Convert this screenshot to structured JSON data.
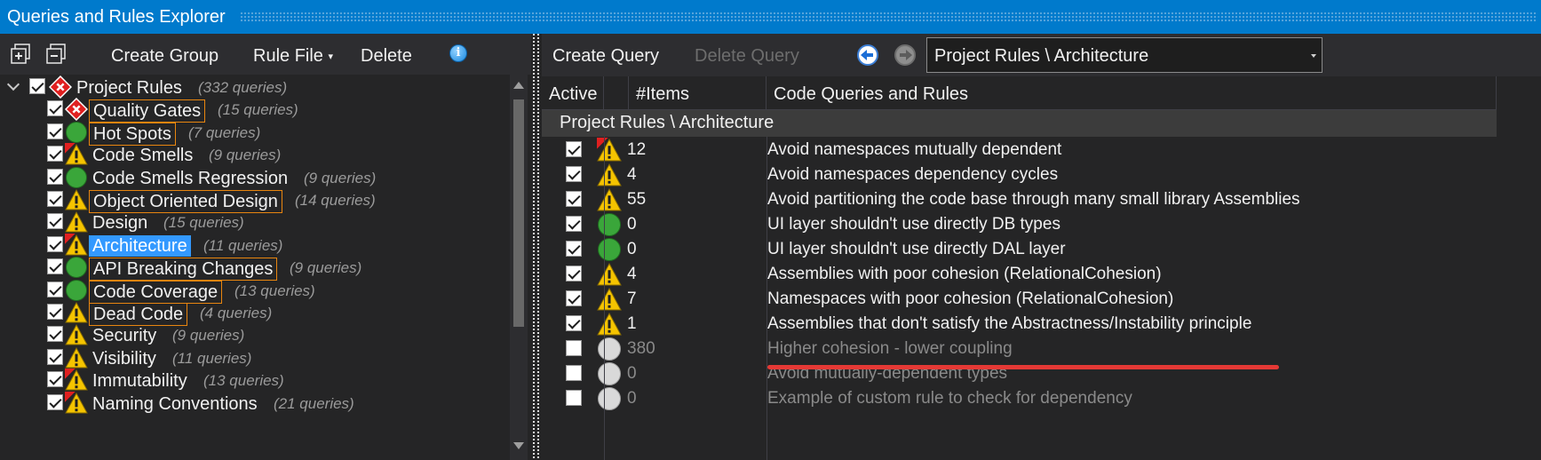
{
  "window": {
    "title": "Queries and Rules Explorer"
  },
  "left_toolbar": {
    "expand_all_icon": "expand-all-icon",
    "collapse_all_icon": "collapse-all-icon",
    "create_group": "Create Group",
    "rule_file": "Rule File",
    "delete": "Delete",
    "info_icon": "info-icon",
    "info_glyph": "i"
  },
  "tree": {
    "root": {
      "label": "Project Rules",
      "count": "(332 queries)",
      "status": "error",
      "checked": true
    },
    "items": [
      {
        "label": "Quality Gates",
        "count": "(15 queries)",
        "status": "error",
        "boxed": true,
        "flag": false
      },
      {
        "label": "Hot Spots",
        "count": "(7 queries)",
        "status": "ok",
        "boxed": true,
        "flag": false
      },
      {
        "label": "Code Smells",
        "count": "(9 queries)",
        "status": "warning",
        "boxed": false,
        "flag": true
      },
      {
        "label": "Code Smells Regression",
        "count": "(9 queries)",
        "status": "ok",
        "boxed": false,
        "flag": false
      },
      {
        "label": "Object Oriented Design",
        "count": "(14 queries)",
        "status": "warning",
        "boxed": true,
        "flag": false
      },
      {
        "label": "Design",
        "count": "(15 queries)",
        "status": "warning",
        "boxed": false,
        "flag": false
      },
      {
        "label": "Architecture",
        "count": "(11 queries)",
        "status": "warning",
        "boxed": false,
        "flag": true,
        "selected": true
      },
      {
        "label": "API Breaking Changes",
        "count": "(9 queries)",
        "status": "ok",
        "boxed": true,
        "flag": false
      },
      {
        "label": "Code Coverage",
        "count": "(13 queries)",
        "status": "ok",
        "boxed": true,
        "flag": false
      },
      {
        "label": "Dead Code",
        "count": "(4 queries)",
        "status": "warning",
        "boxed": true,
        "flag": false
      },
      {
        "label": "Security",
        "count": "(9 queries)",
        "status": "warning",
        "boxed": false,
        "flag": false
      },
      {
        "label": "Visibility",
        "count": "(11 queries)",
        "status": "warning",
        "boxed": false,
        "flag": false
      },
      {
        "label": "Immutability",
        "count": "(13 queries)",
        "status": "warning",
        "boxed": false,
        "flag": true
      },
      {
        "label": "Naming Conventions",
        "count": "(21 queries)",
        "status": "warning",
        "boxed": false,
        "flag": true
      }
    ]
  },
  "right_toolbar": {
    "create_query": "Create Query",
    "delete_query": "Delete Query",
    "back_icon": "back-arrow-icon",
    "forward_icon": "forward-arrow-icon",
    "path_value": "Project Rules \\ Architecture"
  },
  "grid": {
    "headers": {
      "active": "Active",
      "items": "#Items",
      "name": "Code Queries and Rules"
    },
    "group_title": "Project Rules \\ Architecture",
    "rows": [
      {
        "active": true,
        "status": "flag",
        "items": "12",
        "name": "Avoid namespaces mutually dependent"
      },
      {
        "active": true,
        "status": "warning",
        "items": "4",
        "name": "Avoid namespaces dependency cycles"
      },
      {
        "active": true,
        "status": "warning",
        "items": "55",
        "name": "Avoid partitioning the code base through many small library Assemblies"
      },
      {
        "active": true,
        "status": "ok",
        "items": "0",
        "name": "UI layer shouldn't use directly DB types"
      },
      {
        "active": true,
        "status": "ok",
        "items": "0",
        "name": "UI layer shouldn't use directly DAL layer"
      },
      {
        "active": true,
        "status": "warning",
        "items": "4",
        "name": "Assemblies with poor cohesion (RelationalCohesion)"
      },
      {
        "active": true,
        "status": "warning",
        "items": "7",
        "name": "Namespaces with poor cohesion (RelationalCohesion)"
      },
      {
        "active": true,
        "status": "warning",
        "items": "1",
        "name": "Assemblies that don't satisfy the Abstractness/Instability principle"
      },
      {
        "active": false,
        "status": "inactive",
        "items": "380",
        "name": "Higher cohesion - lower coupling"
      },
      {
        "active": false,
        "status": "inactive",
        "items": "0",
        "name": "Avoid mutually-dependent types"
      },
      {
        "active": false,
        "status": "inactive",
        "items": "0",
        "name": "Example of custom rule to check for dependency"
      }
    ]
  },
  "colors": {
    "accent": "#007acc",
    "selected": "#3399ff",
    "ok": "#3aa63a",
    "warning": "#f5c400",
    "error": "#e02020",
    "box": "#e8850f",
    "underline": "#e53935"
  }
}
